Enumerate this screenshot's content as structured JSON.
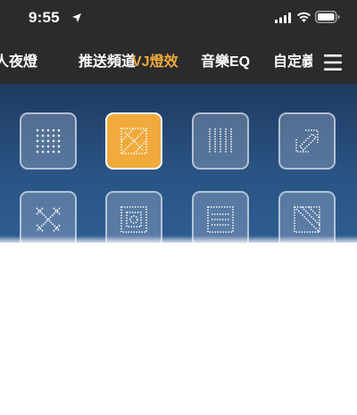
{
  "status_bar": {
    "time": "9:55",
    "location_icon": "location-arrow-icon",
    "signal_icon": "cellular-signal-icon",
    "wifi_icon": "wifi-icon",
    "battery_icon": "battery-icon"
  },
  "tabs": [
    {
      "label": "人夜燈",
      "active": false
    },
    {
      "label": "推送頻道",
      "active": false
    },
    {
      "label": "VJ燈效",
      "active": true
    },
    {
      "label": "音樂EQ",
      "active": false
    },
    {
      "label": "自定義",
      "active": false
    }
  ],
  "menu_icon": "hamburger-menu-icon",
  "colors": {
    "header_bg": "#2b2b2d",
    "active_tab": "#f0a93a",
    "content_gradient_top": "#1e3a5f",
    "content_gradient_bottom": "#2f5d92",
    "selected_effect": "#f0ab3c"
  },
  "effects": [
    {
      "icon": "dot-grid-icon",
      "selected": false
    },
    {
      "icon": "diagonal-pattern-icon",
      "selected": true
    },
    {
      "icon": "vertical-lines-icon",
      "selected": false
    },
    {
      "icon": "diagonal-frame-icon",
      "selected": false
    },
    {
      "icon": "x-cross-pattern-icon",
      "selected": false
    },
    {
      "icon": "concentric-squares-icon",
      "selected": false
    },
    {
      "icon": "horizontal-bars-icon",
      "selected": false
    },
    {
      "icon": "diagonal-split-icon",
      "selected": false
    }
  ]
}
